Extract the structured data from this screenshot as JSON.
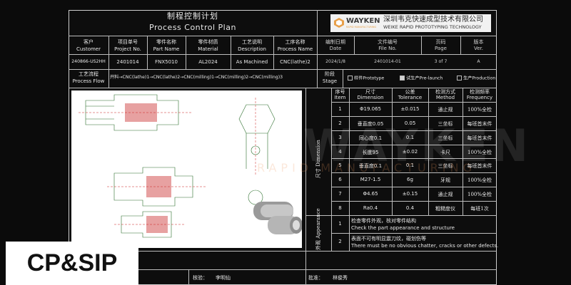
{
  "title": {
    "zh": "制程控制计划",
    "en": "Process Control Plan"
  },
  "company": {
    "logo_text": "WAYKEN",
    "logo_sub": "RAPID MANUFACTURING",
    "zh": "深圳韦克快速成型技术有限公司",
    "en": "WEIKE RAPID PROTOTYPING TECHNOLOGY"
  },
  "header": {
    "customer": {
      "zh": "客户",
      "en": "Customer",
      "value": "240866-US2HH"
    },
    "project": {
      "zh": "项目单号",
      "en": "Project No.",
      "value": "2401014"
    },
    "part": {
      "zh": "零件名称",
      "en": "Part Name",
      "value": "FNX5010"
    },
    "material": {
      "zh": "零件材质",
      "en": "Material",
      "value": "AL2024"
    },
    "description": {
      "zh": "工艺说明",
      "en": "Description",
      "value": "As Machined"
    },
    "process_name": {
      "zh": "工序名称",
      "en": "Process Name",
      "value": "CNC(lathe)2"
    },
    "date": {
      "zh": "编制日期",
      "en": "Date",
      "value": "2024/1/8"
    },
    "file": {
      "zh": "文件编号",
      "en": "File No.",
      "value": "2401014-01"
    },
    "page": {
      "zh": "页码",
      "en": "Page",
      "value": "3 of 7"
    },
    "version": {
      "zh": "版本",
      "en": "Ver.",
      "value": "A"
    }
  },
  "flow": {
    "zh": "工艺流程",
    "en": "Process Flow",
    "value": "开料→CNC(lathe)1→CNC(lathe)2→CNC(milling)1→CNC(milling)2→CNC(milling)3"
  },
  "stage": {
    "zh": "阶段",
    "en": "Stage",
    "options": [
      "样件Prototype",
      "试生产Pre-launch",
      "生产Production"
    ],
    "checked_index": 1
  },
  "dim_table": {
    "section_zh": "尺寸",
    "section_en": "Dimension",
    "headers": [
      {
        "zh": "序号",
        "en": "Item"
      },
      {
        "zh": "尺寸",
        "en": "Dimension"
      },
      {
        "zh": "公差",
        "en": "Tolerance"
      },
      {
        "zh": "检测方式",
        "en": "Method"
      },
      {
        "zh": "检测频率",
        "en": "Frequency"
      }
    ],
    "rows": [
      [
        "1",
        "Φ19.065",
        "±0.015",
        "通止规",
        "100%全检"
      ],
      [
        "2",
        "垂直度0.05",
        "0.05",
        "三坐标",
        "每班首末件"
      ],
      [
        "3",
        "同心度0.1",
        "0.1",
        "三坐标",
        "每班首末件"
      ],
      [
        "4",
        "长度95",
        "±0.02",
        "卡尺",
        "100%全检"
      ],
      [
        "5",
        "垂直度0.1",
        "0.1",
        "三坐标",
        "每班首末件"
      ],
      [
        "6",
        "M27-1.5",
        "6g",
        "牙规",
        "100%全检"
      ],
      [
        "7",
        "Φ4.65",
        "±0.15",
        "通止规",
        "100%全检"
      ],
      [
        "8",
        "Ra0.4",
        "0.4",
        "粗糙度仪",
        "每班1次"
      ]
    ]
  },
  "appearance": {
    "section_zh": "外观",
    "section_en": "Appearance",
    "items": [
      {
        "n": "1",
        "zh": "检查零件外观，核对零件结构",
        "en": "Check the part appearance and structure"
      },
      {
        "n": "2",
        "zh": "表面不可有明显震刀纹，碰划伤等",
        "en": "There must be no obvious chatter, cracks or other defects."
      }
    ]
  },
  "footer": {
    "check_label": "核验：",
    "check_name": "李明仙",
    "approve_label": "批准：",
    "approve_name": "林俊秀"
  },
  "watermark": {
    "main": "WAYKEN",
    "sub": "RAPID MANUFACTURING"
  },
  "overlay_badge": "CP&SIP",
  "colors": {
    "background": "#0b0b0b",
    "lines": "#bdbdbd",
    "text": "#e8e8e8",
    "logo_accent": "#e8a04a"
  }
}
